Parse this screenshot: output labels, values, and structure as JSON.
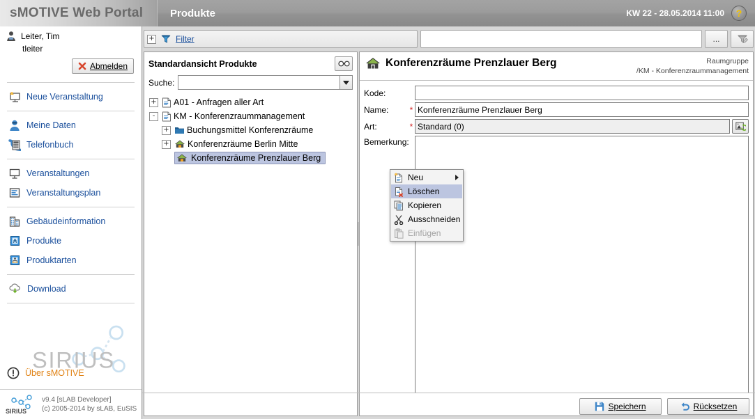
{
  "header": {
    "brand": "sMOTIVE Web Portal",
    "page_title": "Produkte",
    "kw_text": "KW 22 - 28.05.2014 11:00",
    "help_glyph": "?"
  },
  "sidebar": {
    "user": {
      "name": "Leiter, Tim",
      "login": "tleiter"
    },
    "logout_label": "Abmelden",
    "items": [
      {
        "label": "Neue Veranstaltung",
        "icon": "new-event-icon"
      },
      {
        "label": "Meine Daten",
        "icon": "user-data-icon"
      },
      {
        "label": "Telefonbuch",
        "icon": "phonebook-icon"
      },
      {
        "label": "Veranstaltungen",
        "icon": "events-icon"
      },
      {
        "label": "Veranstaltungsplan",
        "icon": "event-plan-icon"
      },
      {
        "label": "Gebäudeinformation",
        "icon": "building-icon"
      },
      {
        "label": "Produkte",
        "icon": "products-icon"
      },
      {
        "label": "Produktarten",
        "icon": "product-types-icon"
      },
      {
        "label": "Download",
        "icon": "download-icon"
      }
    ],
    "logo_text": "SIRIUS",
    "about_label": "Über sMOTIVE",
    "footer": {
      "line1": "v9.4 [sLAB Developer]",
      "line2": "(c) 2005-2014 by sLAB, EuSIS",
      "logo_text": "SIRIUS"
    }
  },
  "filterbar": {
    "expander_glyph": "+",
    "filter_label": "Filter",
    "filter_value": "",
    "filter_placeholder": "",
    "more_label": "...",
    "edit_filter_title": "Filter bearbeiten"
  },
  "tree": {
    "title": "Standardansicht Produkte",
    "glasses_title": "Ansicht",
    "search_label": "Suche:",
    "search_value": "",
    "search_placeholder": "",
    "nodes": [
      {
        "label": "A01 - Anfragen aller Art",
        "icon": "document-icon",
        "toggle": "+",
        "indent": 0,
        "selected": false
      },
      {
        "label": "KM - Konferenzraummanagement",
        "icon": "document-icon",
        "toggle": "-",
        "indent": 0,
        "selected": false
      },
      {
        "label": "Buchungsmittel Konferenzräume",
        "icon": "folder-icon",
        "toggle": "+",
        "indent": 1,
        "selected": false
      },
      {
        "label": "Konferenzräume Berlin Mitte",
        "icon": "house-icon",
        "toggle": "+",
        "indent": 1,
        "selected": false
      },
      {
        "label": "Konferenzräume Prenzlauer Berg",
        "icon": "house-icon",
        "toggle": "",
        "indent": 1,
        "selected": true
      }
    ]
  },
  "context_menu": {
    "items": [
      {
        "label": "Neu",
        "icon": "new-document-icon",
        "submenu": true,
        "highlighted": false,
        "disabled": false
      },
      {
        "label": "Löschen",
        "icon": "delete-document-icon",
        "submenu": false,
        "highlighted": true,
        "disabled": false
      },
      {
        "label": "Kopieren",
        "icon": "copy-icon",
        "submenu": false,
        "highlighted": false,
        "disabled": false
      },
      {
        "label": "Ausschneiden",
        "icon": "scissors-icon",
        "submenu": false,
        "highlighted": false,
        "disabled": false
      },
      {
        "label": "Einfügen",
        "icon": "paste-icon",
        "submenu": false,
        "highlighted": false,
        "disabled": true
      }
    ]
  },
  "detail": {
    "title": "Konferenzräume Prenzlauer Berg",
    "meta_type": "Raumgruppe",
    "meta_path": "/KM - Konferenzraummanagement",
    "fields": {
      "kode_label": "Kode:",
      "kode_value": "",
      "name_label": "Name:",
      "name_value": "Konferenzräume Prenzlauer Berg",
      "art_label": "Art:",
      "art_value": "Standard (0)",
      "bemerkung_label": "Bemerkung:",
      "bemerkung_value": "",
      "required_marker": "*"
    }
  },
  "actions": {
    "save_label": "Speichern",
    "reset_label": "Rücksetzen"
  },
  "colors": {
    "accent_link": "#1a4f9c",
    "required": "#d02020",
    "selection": "#bcc5e0",
    "orange": "#e08214",
    "header_gray": "#929292"
  }
}
